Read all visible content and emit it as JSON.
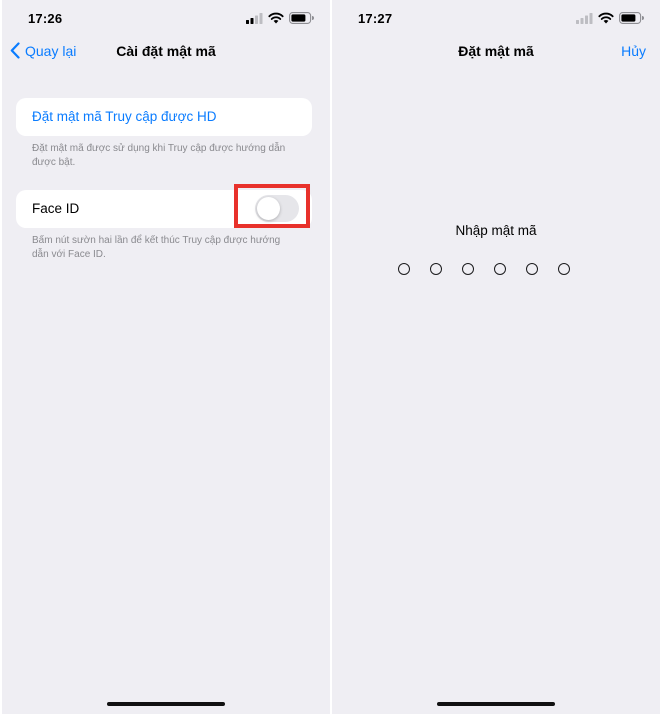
{
  "left_screen": {
    "status_time": "17:26",
    "nav": {
      "back_label": "Quay lại",
      "title": "Cài đặt mật mã"
    },
    "set_passcode_link": "Đặt mật mã Truy cập được HD",
    "set_passcode_footnote": "Đặt mật mã được sử dụng khi Truy cập được hướng dẫn được bật.",
    "face_id": {
      "label": "Face ID",
      "toggle_state": "off"
    },
    "face_id_footnote": "Bấm nút sườn hai lần để kết thúc Truy cập được hướng dẫn với Face ID."
  },
  "right_screen": {
    "status_time": "17:27",
    "nav": {
      "title": "Đặt mật mã",
      "cancel_label": "Hủy"
    },
    "prompt": "Nhập mật mã",
    "passcode_length": 6,
    "digits_entered": 0
  },
  "icons": [
    "chevron-left-icon",
    "cellular-signal-icon",
    "wifi-icon",
    "battery-icon"
  ],
  "colors": {
    "accent": "#0a7cff",
    "background": "#efeef3",
    "highlight": "#e8312b",
    "toggle_off": "#e6e6ea"
  }
}
